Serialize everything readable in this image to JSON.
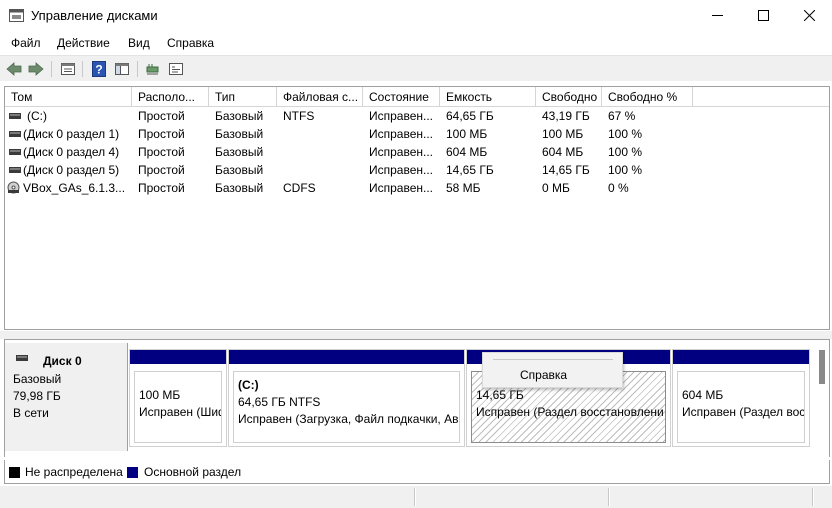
{
  "window": {
    "title": "Управление дисками",
    "controls": [
      "minimize",
      "maximize",
      "close"
    ]
  },
  "menu": {
    "items": [
      "Файл",
      "Действие",
      "Вид",
      "Справка"
    ]
  },
  "toolbar": {
    "icons": [
      "back-arrow-icon",
      "forward-arrow-icon",
      "properties-icon",
      "help-icon",
      "show-hide-pane-icon",
      "connect-icon",
      "console-icon"
    ]
  },
  "volume_list": {
    "columns": [
      "Том",
      "Располо...",
      "Тип",
      "Файловая с...",
      "Состояние",
      "Емкость",
      "Свободно",
      "Свободно %"
    ],
    "rows": [
      {
        "name": "(C:)",
        "layout": "Простой",
        "type": "Базовый",
        "fs": "NTFS",
        "status": "Исправен...",
        "capacity": "64,65 ГБ",
        "free": "43,19 ГБ",
        "free_pct": "67 %",
        "icon": "volume-icon"
      },
      {
        "name": "(Диск 0 раздел 1)",
        "layout": "Простой",
        "type": "Базовый",
        "fs": "",
        "status": "Исправен...",
        "capacity": "100 МБ",
        "free": "100 МБ",
        "free_pct": "100 %",
        "icon": "volume-icon"
      },
      {
        "name": "(Диск 0 раздел 4)",
        "layout": "Простой",
        "type": "Базовый",
        "fs": "",
        "status": "Исправен...",
        "capacity": "604 МБ",
        "free": "604 МБ",
        "free_pct": "100 %",
        "icon": "volume-icon"
      },
      {
        "name": "(Диск 0 раздел 5)",
        "layout": "Простой",
        "type": "Базовый",
        "fs": "",
        "status": "Исправен...",
        "capacity": "14,65 ГБ",
        "free": "14,65 ГБ",
        "free_pct": "100 %",
        "icon": "volume-icon"
      },
      {
        "name": "VBox_GAs_6.1.3...",
        "layout": "Простой",
        "type": "Базовый",
        "fs": "CDFS",
        "status": "Исправен...",
        "capacity": "58 МБ",
        "free": "0 МБ",
        "free_pct": "0 %",
        "icon": "cd-drive-icon"
      }
    ]
  },
  "disk0": {
    "title": "Диск 0",
    "type": "Базовый",
    "size": "79,98 ГБ",
    "state": "В сети",
    "partitions": [
      {
        "name": "",
        "size": "100 МБ",
        "status": "Исправен (Шиф"
      },
      {
        "name": "(C:)",
        "size": "64,65 ГБ NTFS",
        "status": "Исправен (Загрузка, Файл подкачки, Ав"
      },
      {
        "name": "",
        "size": "14,65 ГБ",
        "status": "Исправен (Раздел восстановлени"
      },
      {
        "name": "",
        "size": "604 МБ",
        "status": "Исправен (Раздел вос"
      }
    ]
  },
  "tooltip": {
    "text": "Справка"
  },
  "legend": {
    "items": [
      {
        "label": "Не распределена",
        "color": "#000000"
      },
      {
        "label": "Основной раздел",
        "color": "#000080"
      }
    ]
  }
}
